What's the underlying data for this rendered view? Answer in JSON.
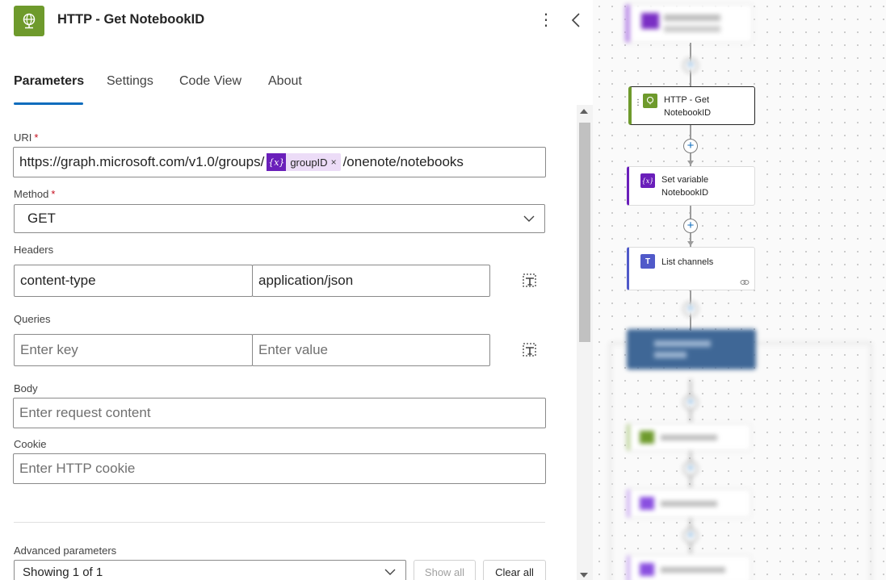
{
  "header": {
    "title": "HTTP - Get NotebookID",
    "more_label": "⋮"
  },
  "tabs": [
    {
      "label": "Parameters"
    },
    {
      "label": "Settings"
    },
    {
      "label": "Code View"
    },
    {
      "label": "About"
    }
  ],
  "fields": {
    "uri": {
      "label": "URI",
      "required_mark": "*",
      "prefix": "https://graph.microsoft.com/v1.0/groups/",
      "token_icon": "{x}",
      "token_label": "groupID",
      "token_remove": "×",
      "suffix": "/onenote/notebooks"
    },
    "method": {
      "label": "Method",
      "required_mark": "*",
      "value": "GET"
    },
    "headers": {
      "label": "Headers",
      "key": "content-type",
      "value": "application/json"
    },
    "queries": {
      "label": "Queries",
      "key_placeholder": "Enter key",
      "value_placeholder": "Enter value"
    },
    "body": {
      "label": "Body",
      "placeholder": "Enter request content"
    },
    "cookie": {
      "label": "Cookie",
      "placeholder": "Enter HTTP cookie"
    }
  },
  "advanced": {
    "label": "Advanced parameters",
    "selected": "Showing 1 of 1",
    "show_all": "Show all",
    "clear_all": "Clear all"
  },
  "flow": {
    "http_card": {
      "line1": "HTTP - Get",
      "line2": "NotebookID"
    },
    "set_var_card": {
      "line1": "Set variable",
      "line2": "NotebookID"
    },
    "list_channels_card": {
      "line1": "List channels"
    }
  },
  "colors": {
    "accent": "#0f6cbd",
    "http_green": "#6e9a2c",
    "variable_purple": "#6a1fba",
    "teams_blue": "#5059c9"
  }
}
